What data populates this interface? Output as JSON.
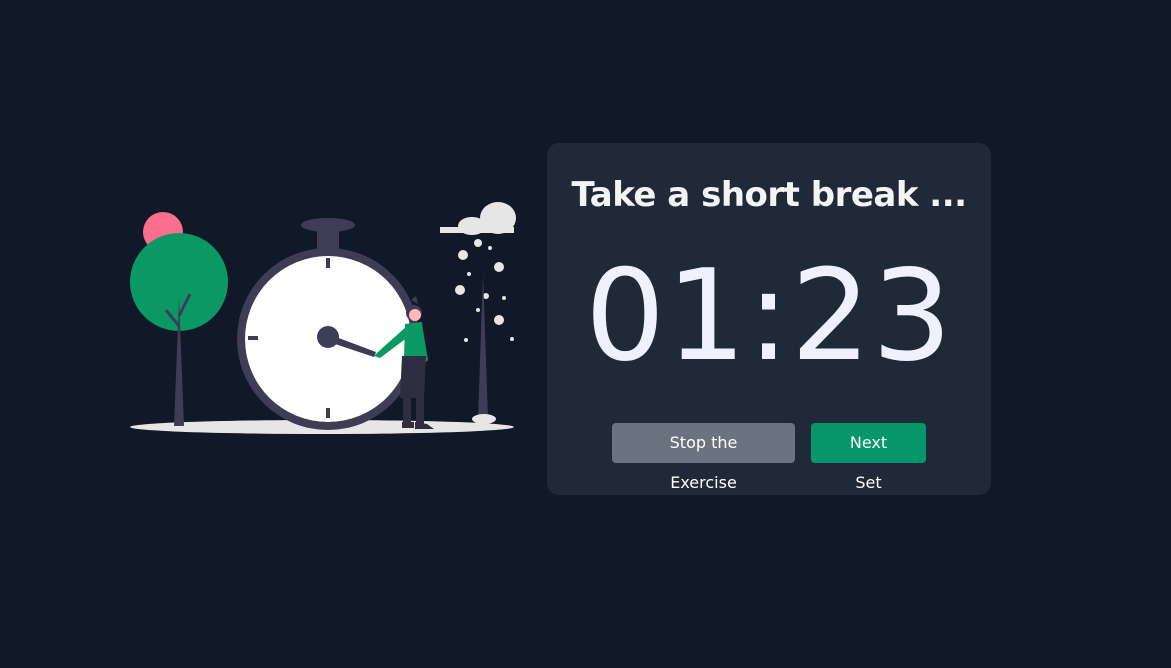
{
  "break_card": {
    "title": "Take a short break ...",
    "timer": "01:23",
    "stop_label": "Stop the Exercise",
    "next_label": "Next Set"
  },
  "colors": {
    "background": "#111827",
    "card": "#1f2937",
    "stop_button": "#6b7280",
    "next_button": "#059669",
    "accent_green": "#059669",
    "accent_pink": "#fb6e8d"
  },
  "illustration": {
    "icon": "stopwatch-break-illustration"
  }
}
